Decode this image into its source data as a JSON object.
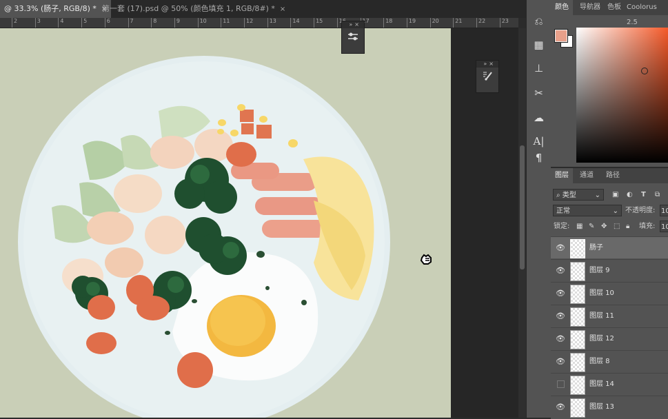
{
  "tabs": [
    {
      "label": "@ 33.3% (肠子, RGB/8) *",
      "close": "×",
      "active": true
    },
    {
      "label": "第一套 (17).psd @ 50% (颜色填充 1, RGB/8#) *",
      "close": "×",
      "active": false
    }
  ],
  "ruler": {
    "ticks": [
      "2",
      "3",
      "4",
      "5",
      "6",
      "7",
      "8",
      "9",
      "10",
      "11",
      "12",
      "13",
      "14",
      "15",
      "16",
      "17",
      "18",
      "19",
      "20",
      "21",
      "22",
      "23"
    ]
  },
  "color_panel": {
    "tabs": [
      "颜色",
      "导航器",
      "色板",
      "Coolorus 2.5"
    ],
    "active_tab": "颜色",
    "foreground_color": "#e8a08a",
    "background_color": "#ffffff",
    "hue_color": "#f55a2a"
  },
  "layers_panel": {
    "tabs": [
      "图层",
      "通道",
      "路径"
    ],
    "active_tab": "图层",
    "filter_label": "类型",
    "blend_mode": "正常",
    "opacity_label": "不透明度:",
    "opacity_value": "10",
    "lock_label": "锁定:",
    "fill_label": "填充:",
    "fill_value": "10",
    "layers": [
      {
        "name": "肠子",
        "visible": true,
        "selected": true
      },
      {
        "name": "图层 9",
        "visible": true,
        "selected": false
      },
      {
        "name": "图层 10",
        "visible": true,
        "selected": false
      },
      {
        "name": "图层 11",
        "visible": true,
        "selected": false
      },
      {
        "name": "图层 12",
        "visible": true,
        "selected": false
      },
      {
        "name": "图层 8",
        "visible": true,
        "selected": false
      },
      {
        "name": "图层 14",
        "visible": false,
        "selected": false
      },
      {
        "name": "图层 13",
        "visible": true,
        "selected": false
      }
    ]
  },
  "icon_strip": [
    "history-icon",
    "layer-comp-icon",
    "stamp-icon",
    "tools-icon",
    "libraries-icon",
    "character-icon",
    "paragraph-icon"
  ],
  "floating_panels": {
    "collapse_glyph": "»",
    "close_glyph": "×"
  }
}
